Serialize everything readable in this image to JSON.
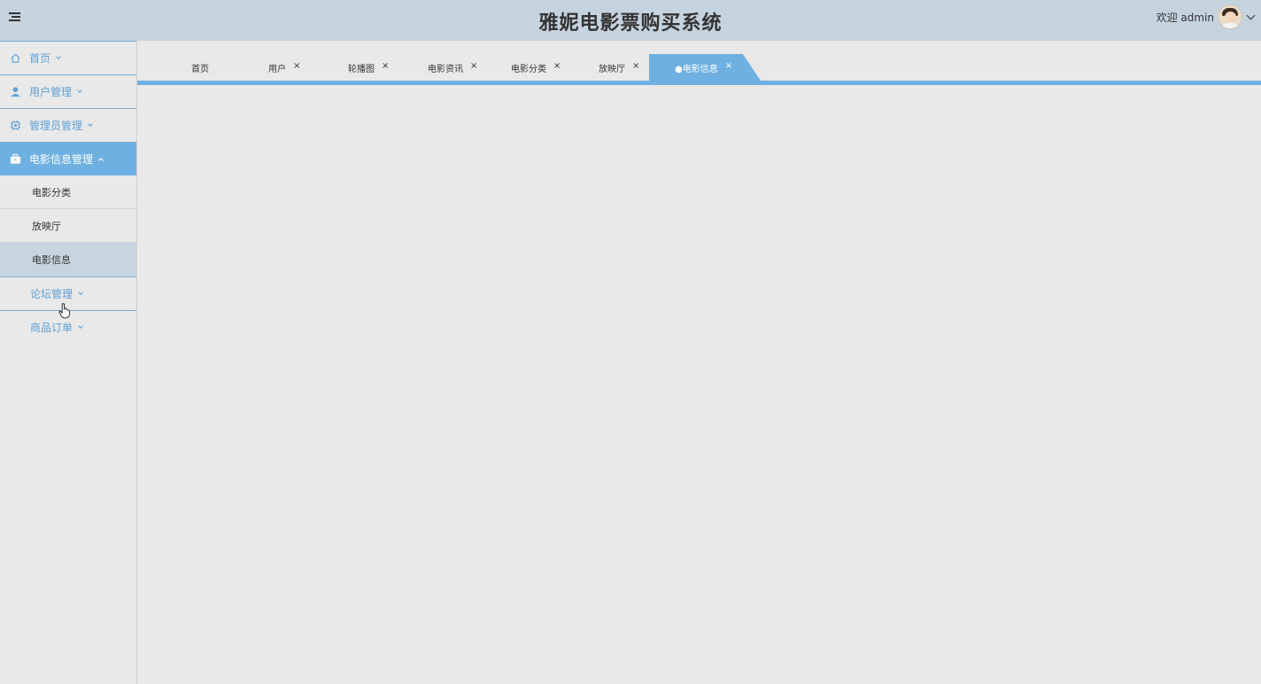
{
  "header": {
    "title": "雅妮电影票购买系统",
    "welcome": "欢迎 admin",
    "menu_icon": "hamburger-icon",
    "avatar_icon": "user-avatar"
  },
  "sidebar": {
    "items": [
      {
        "label": "首页",
        "icon": "home-icon"
      },
      {
        "label": "用户管理",
        "icon": "user-icon"
      },
      {
        "label": "管理员管理",
        "icon": "chip-icon"
      },
      {
        "label": "电影信息管理",
        "icon": "briefcase-icon"
      },
      {
        "label": "论坛管理",
        "icon": ""
      },
      {
        "label": "商品订单",
        "icon": ""
      }
    ],
    "sub_items": [
      {
        "label": "电影分类"
      },
      {
        "label": "放映厅"
      },
      {
        "label": "电影信息"
      }
    ]
  },
  "tabs": [
    {
      "label": "首页",
      "closable": false
    },
    {
      "label": "用户",
      "closable": true
    },
    {
      "label": "轮播图",
      "closable": true
    },
    {
      "label": "电影资讯",
      "closable": true
    },
    {
      "label": "电影分类",
      "closable": true
    },
    {
      "label": "放映厅",
      "closable": true
    },
    {
      "label": "●电影信息",
      "closable": true
    }
  ],
  "close_glyph": "×",
  "colors": {
    "accent": "#6fb0e2",
    "header_bg": "#c5d3df",
    "page_bg": "#e9e9e9",
    "sidebar_text": "#5ea0d6"
  }
}
